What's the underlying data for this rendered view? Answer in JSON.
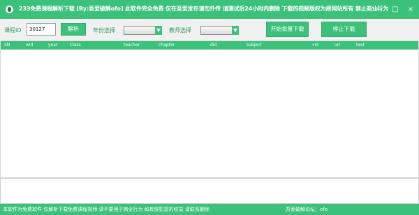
{
  "window": {
    "title": "233免费课程解析下载 [By:吾爱破解ofo] 此软件完全免费 仅在吾爱发布请勿外传 请测试后24小时内删除 下载的视频版权为原网站所有 禁止商业行为",
    "controls": {
      "minimize": "—",
      "maximize": "□",
      "close": "×"
    }
  },
  "toolbar": {
    "course_id_label": "课程ID",
    "course_id_value": "30127",
    "parse_button": "解析",
    "year_label": "年份选择",
    "teacher_label": "教师选择",
    "batch_download_button": "开始批量下载",
    "stop_download_button": "停止下载"
  },
  "table": {
    "columns": [
      "SN",
      "wid",
      "year",
      "Class",
      "teacher",
      "chapter",
      "did",
      "subject",
      "vid",
      "url",
      "text"
    ]
  },
  "status_bar": {
    "left_text": "本软件为免费软件 仅解析下载免费课程视频 请不要用于商业行为 如有侵犯您的权益 请联系删除",
    "right_text": "吾爱破解论坛：ofo"
  },
  "colors": {
    "accent": "#3cc17b",
    "toolbar_bg": "#f0f0f0",
    "label_green": "#2f9a63"
  }
}
